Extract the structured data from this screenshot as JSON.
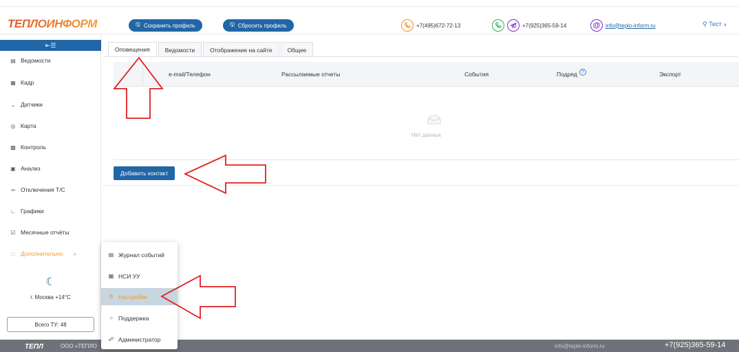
{
  "header": {
    "logo_text": "ТЕПЛОИНФОРМ",
    "save_profile": "Сохранить профиль",
    "reset_profile": "Сбросить профиль",
    "phone_1": "+7(495)672-72-13",
    "phone_2": "+7(925)365-59-14",
    "email": "info@teplo-inform.ru",
    "user": "Тест"
  },
  "sidebar": {
    "items": [
      {
        "label": "Ведомости",
        "icon": "document-icon"
      },
      {
        "label": "Кадр",
        "icon": "grid-icon"
      },
      {
        "label": "Датчики",
        "icon": "sensor-icon"
      },
      {
        "label": "Карта",
        "icon": "map-pin-icon"
      },
      {
        "label": "Контроль",
        "icon": "control-icon"
      },
      {
        "label": "Анализ",
        "icon": "analysis-icon"
      },
      {
        "label": "Отключения Т/С",
        "icon": "link-icon"
      },
      {
        "label": "Графики",
        "icon": "chart-icon"
      },
      {
        "label": "Месячные отчёты",
        "icon": "calendar-check-icon"
      },
      {
        "label": "Дополнительно",
        "icon": "folder-icon"
      }
    ],
    "weather": "г. Москва +14°C",
    "tu_count": "Всего ТУ: 48"
  },
  "tabs": [
    "Оповещения",
    "Ведомости",
    "Отображение на сайте",
    "Общее"
  ],
  "table": {
    "columns": [
      "e-mail/Телефон",
      "Рассылаемые отчеты",
      "События",
      "Подряд",
      "Экспорт"
    ],
    "empty_text": "Нет данных"
  },
  "add_contact": "Добавить контакт",
  "submenu": [
    "Журнал событий",
    "НСИ УУ",
    "Настройки",
    "Поддержка",
    "Администратор"
  ],
  "footer": {
    "company": "ООО «ТЕПЛО",
    "email": "info@teplo-inform.ru",
    "phone": "+7(925)365-59-14"
  },
  "colors": {
    "primary": "#2166a6",
    "accent": "#ec9a2c",
    "arrow": "#e41e1e",
    "footer": "#6f7379"
  }
}
